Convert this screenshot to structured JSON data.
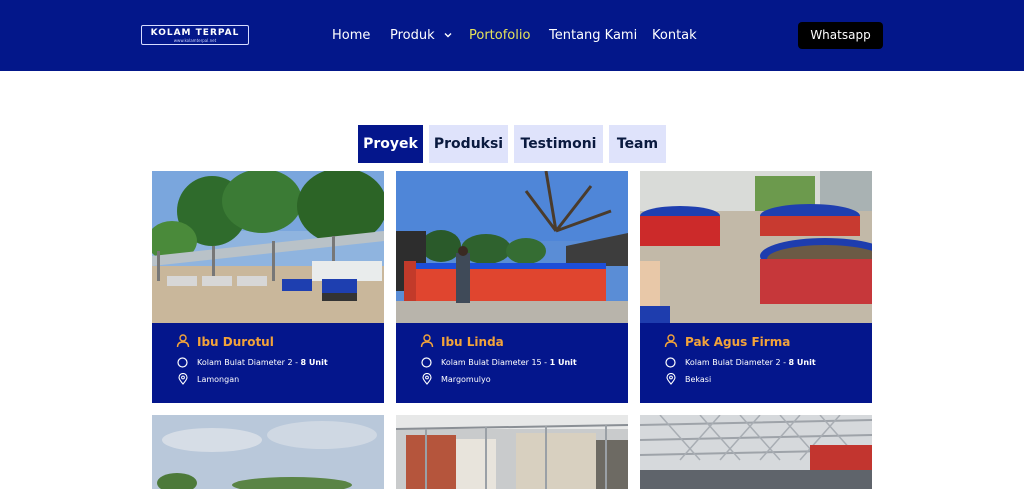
{
  "header": {
    "logo_text": "KOLAM TERPAL",
    "logo_url": "www.kolamterpal.net",
    "nav": [
      {
        "label": "Home"
      },
      {
        "label": "Produk"
      },
      {
        "label": "Portofolio"
      },
      {
        "label": "Tentang Kami"
      },
      {
        "label": "Kontak"
      }
    ],
    "active_nav": "Portofolio",
    "whatsapp_label": "Whatsapp"
  },
  "tabs": [
    {
      "label": "Proyek",
      "active": true
    },
    {
      "label": "Produksi",
      "active": false
    },
    {
      "label": "Testimoni",
      "active": false
    },
    {
      "label": "Team",
      "active": false
    }
  ],
  "projects": [
    {
      "client": "Ibu Durotul",
      "spec": "Kolam Bulat Diameter 2 - ",
      "qty": "8 Unit",
      "location": "Lamongan"
    },
    {
      "client": "Ibu Linda",
      "spec": "Kolam Bulat Diameter 15 - ",
      "qty": "1 Unit",
      "location": "Margomulyo"
    },
    {
      "client": "Pak Agus Firma",
      "spec": "Kolam Bulat Diameter 2 - ",
      "qty": "8 Unit",
      "location": "Bekasi"
    }
  ],
  "colors": {
    "navy": "#04168c",
    "accent_orange": "#f2a33a",
    "active_nav": "#e6e35a",
    "tab_inactive": "#dfe3fb"
  },
  "icons": {
    "person": "person-icon",
    "circle": "circle-icon",
    "location": "map-pin-icon",
    "chevron": "chevron-down-icon"
  }
}
